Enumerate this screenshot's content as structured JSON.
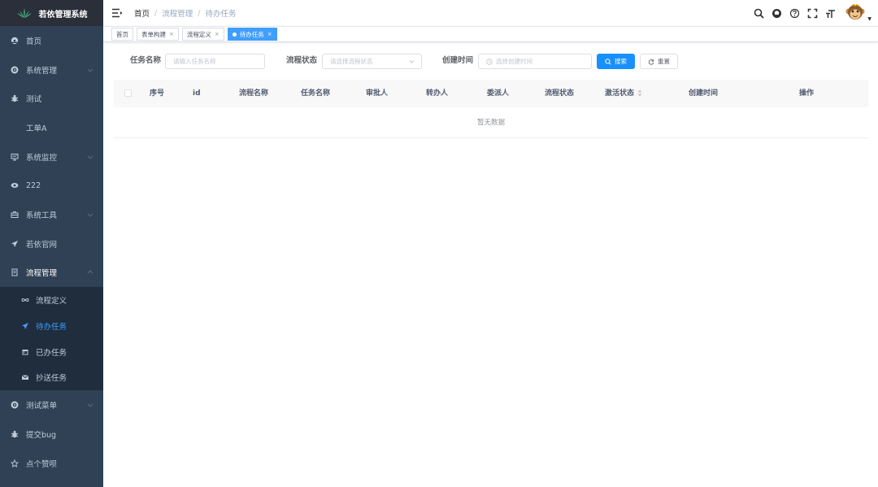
{
  "app": {
    "title": "若依管理系统"
  },
  "sidebar": {
    "items": [
      {
        "label": "首页",
        "icon": "dashboard-icon"
      },
      {
        "label": "系统管理",
        "icon": "gear-icon",
        "chevron": true
      },
      {
        "label": "测试",
        "icon": "bug-icon"
      },
      {
        "label": "工单A",
        "icon": ""
      },
      {
        "label": "系统监控",
        "icon": "monitor-icon",
        "chevron": true
      },
      {
        "label": "222",
        "icon": "eye-icon"
      },
      {
        "label": "系统工具",
        "icon": "toolbox-icon",
        "chevron": true
      },
      {
        "label": "若依官网",
        "icon": "paper-plane-icon"
      },
      {
        "label": "流程管理",
        "icon": "list-icon",
        "chevron": true,
        "open": true
      }
    ],
    "subitems": [
      {
        "label": "流程定义",
        "icon": "infinity-icon"
      },
      {
        "label": "待办任务",
        "icon": "paper-plane-icon",
        "active": true
      },
      {
        "label": "已办任务",
        "icon": "calendar-icon"
      },
      {
        "label": "抄送任务",
        "icon": "mail-icon"
      }
    ],
    "items_after": [
      {
        "label": "测试菜单",
        "icon": "gear-icon",
        "chevron": true
      },
      {
        "label": "提交bug",
        "icon": "bug-icon"
      },
      {
        "label": "点个赞呗",
        "icon": "star-icon"
      }
    ]
  },
  "breadcrumb": [
    "首页",
    "流程管理",
    "待办任务"
  ],
  "tags": [
    {
      "label": "首页",
      "closable": false
    },
    {
      "label": "表单构建",
      "closable": true
    },
    {
      "label": "流程定义",
      "closable": true
    },
    {
      "label": "待办任务",
      "closable": true,
      "active": true
    }
  ],
  "search": {
    "task_name_label": "任务名称",
    "task_name_placeholder": "请输入任务名称",
    "status_label": "流程状态",
    "status_placeholder": "请选择流程状态",
    "time_label": "创建时间",
    "time_placeholder": "选择创建时间",
    "search_btn": "搜索",
    "reset_btn": "重置"
  },
  "table": {
    "columns": [
      "序号",
      "id",
      "流程名称",
      "任务名称",
      "审批人",
      "转办人",
      "委派人",
      "流程状态",
      "激活状态",
      "创建时间",
      "操作"
    ],
    "empty_text": "暂无数据"
  },
  "colors": {
    "sidebar_bg": "#304156",
    "submenu_bg": "#1f2d3d",
    "accent": "#409eff",
    "primary_btn": "#1890ff"
  }
}
